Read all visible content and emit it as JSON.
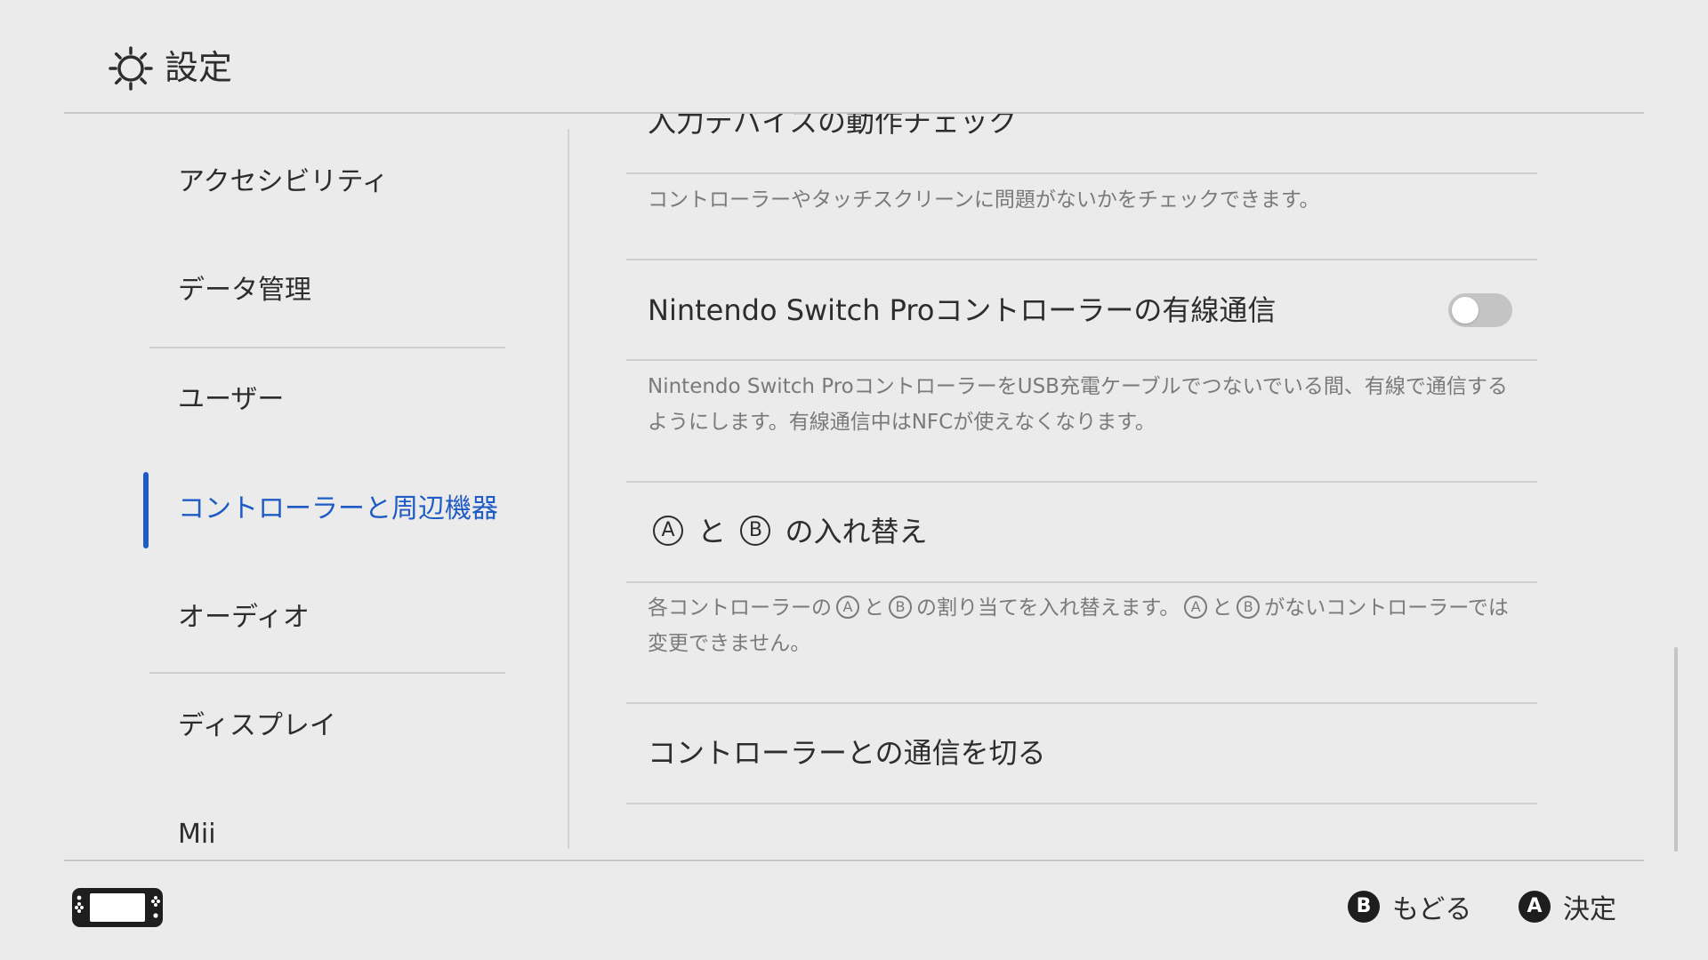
{
  "header": {
    "title": "設定",
    "icon": "gear-icon"
  },
  "sidebar": {
    "items": [
      {
        "label": "アクセシビリティ",
        "active": false
      },
      {
        "label": "データ管理",
        "active": false
      },
      {
        "label": "ユーザー",
        "active": false
      },
      {
        "label": "コントローラーと周辺機器",
        "active": true
      },
      {
        "label": "オーディオ",
        "active": false
      },
      {
        "label": "ディスプレイ",
        "active": false
      },
      {
        "label": "Mii",
        "active": false
      }
    ],
    "active_color": "#1f5bc4"
  },
  "main": {
    "input_check": {
      "title": "入力デバイスの動作チェック",
      "description": "コントローラーやタッチスクリーンに問題がないかをチェックできます。"
    },
    "pro_wired": {
      "title": "Nintendo Switch Proコントローラーの有線通信",
      "toggle_on": false,
      "description": "Nintendo Switch ProコントローラーをUSB充電ケーブルでつないでいる間、有線で通信するようにします。有線通信中はNFCが使えなくなります。"
    },
    "swap_ab": {
      "glyph_a": "A",
      "connector": "と",
      "glyph_b": "B",
      "title_suffix": "の入れ替え",
      "desc_part1": "各コントローラーの",
      "desc_part2": "の割り当てを入れ替えます。",
      "desc_part3": "がないコントローラーでは変更できません。"
    },
    "disconnect": {
      "title": "コントローラーとの通信を切る"
    }
  },
  "footer": {
    "back": {
      "glyph": "B",
      "label": "もどる"
    },
    "confirm": {
      "glyph": "A",
      "label": "決定"
    },
    "console_icon": "switch-console-icon"
  }
}
